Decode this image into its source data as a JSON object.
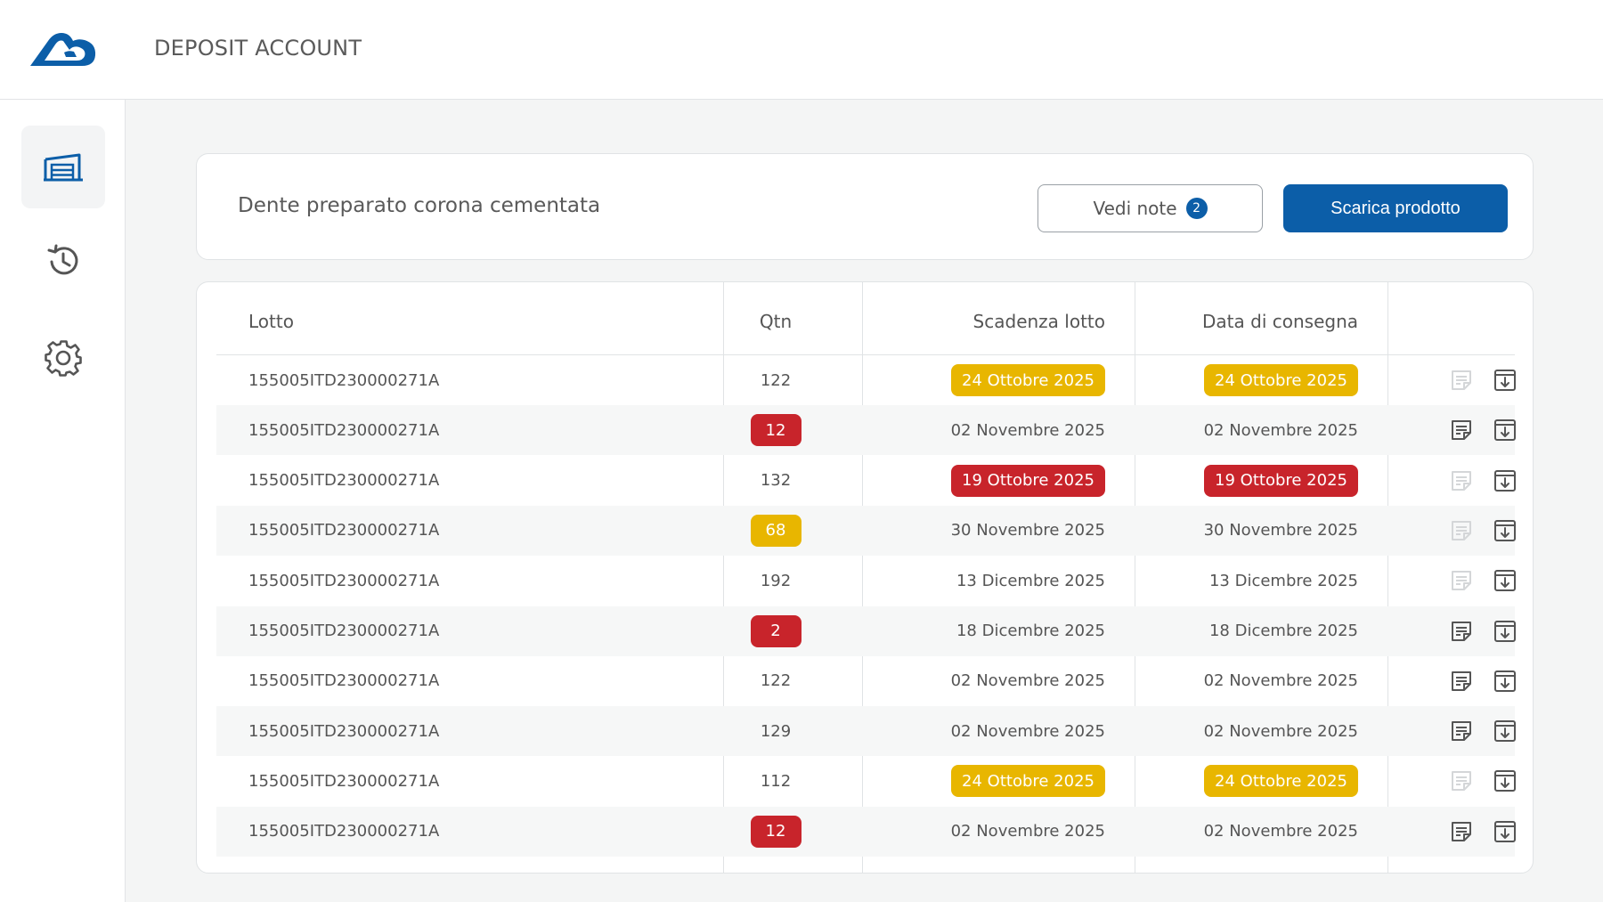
{
  "app": {
    "title": "DEPOSIT ACCOUNT",
    "logo": "cloud-logo-icon",
    "accent": "#0c5ea8"
  },
  "sidebar": {
    "items": [
      {
        "name": "warehouse",
        "icon": "warehouse-icon",
        "active": true
      },
      {
        "name": "history",
        "icon": "history-icon",
        "active": false
      },
      {
        "name": "settings",
        "icon": "gear-icon",
        "active": false
      }
    ]
  },
  "product": {
    "title": "Dente preparato corona cementata",
    "notes_label": "Vedi note",
    "notes_count": "2",
    "download_label": "Scarica prodotto"
  },
  "table": {
    "headers": {
      "lot": "Lotto",
      "qty": "Qtn",
      "expiry": "Scadenza lotto",
      "delivery": "Data di consegna"
    },
    "rows": [
      {
        "lot": "155005ITD230000271A",
        "qty": "122",
        "qty_status": "",
        "expiry": "24 Ottobre 2025",
        "expiry_status": "yellow",
        "delivery": "24 Ottobre 2025",
        "delivery_status": "yellow",
        "note_enabled": false
      },
      {
        "lot": "155005ITD230000271A",
        "qty": "12",
        "qty_status": "red",
        "expiry": "02 Novembre 2025",
        "expiry_status": "",
        "delivery": "02 Novembre 2025",
        "delivery_status": "",
        "note_enabled": true
      },
      {
        "lot": "155005ITD230000271A",
        "qty": "132",
        "qty_status": "",
        "expiry": "19 Ottobre 2025",
        "expiry_status": "red",
        "delivery": "19 Ottobre 2025",
        "delivery_status": "red",
        "note_enabled": false
      },
      {
        "lot": "155005ITD230000271A",
        "qty": "68",
        "qty_status": "yellow",
        "expiry": "30 Novembre 2025",
        "expiry_status": "",
        "delivery": "30 Novembre 2025",
        "delivery_status": "",
        "note_enabled": false
      },
      {
        "lot": "155005ITD230000271A",
        "qty": "192",
        "qty_status": "",
        "expiry": "13 Dicembre 2025",
        "expiry_status": "",
        "delivery": "13 Dicembre 2025",
        "delivery_status": "",
        "note_enabled": false
      },
      {
        "lot": "155005ITD230000271A",
        "qty": "2",
        "qty_status": "red",
        "expiry": "18 Dicembre 2025",
        "expiry_status": "",
        "delivery": "18 Dicembre 2025",
        "delivery_status": "",
        "note_enabled": true
      },
      {
        "lot": "155005ITD230000271A",
        "qty": "122",
        "qty_status": "",
        "expiry": "02 Novembre 2025",
        "expiry_status": "",
        "delivery": "02 Novembre 2025",
        "delivery_status": "",
        "note_enabled": true
      },
      {
        "lot": "155005ITD230000271A",
        "qty": "129",
        "qty_status": "",
        "expiry": "02 Novembre 2025",
        "expiry_status": "",
        "delivery": "02 Novembre 2025",
        "delivery_status": "",
        "note_enabled": true
      },
      {
        "lot": "155005ITD230000271A",
        "qty": "112",
        "qty_status": "",
        "expiry": "24 Ottobre 2025",
        "expiry_status": "yellow",
        "delivery": "24 Ottobre 2025",
        "delivery_status": "yellow",
        "note_enabled": false
      },
      {
        "lot": "155005ITD230000271A",
        "qty": "12",
        "qty_status": "red",
        "expiry": "02 Novembre 2025",
        "expiry_status": "",
        "delivery": "02 Novembre 2025",
        "delivery_status": "",
        "note_enabled": true
      }
    ]
  },
  "colors": {
    "status_red": "#c8242b",
    "status_yellow": "#e8b600",
    "icon_active": "#555555",
    "icon_disabled": "#d4d6d8"
  }
}
